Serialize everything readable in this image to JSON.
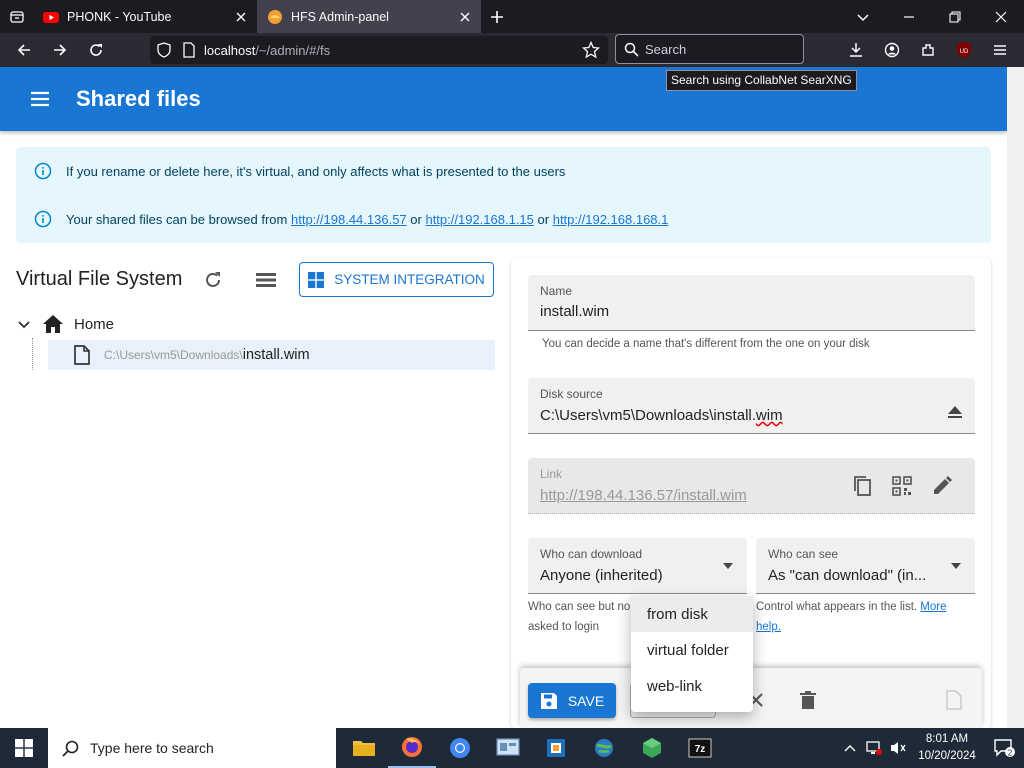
{
  "browser": {
    "tabs": [
      {
        "title": "PHONK - YouTube",
        "active": false
      },
      {
        "title": "HFS Admin-panel",
        "active": true
      }
    ],
    "url_host": "localhost",
    "url_path": "/~/admin/#/fs",
    "search_placeholder": "Search",
    "search_tooltip": "Search using CollabNet SearXNG",
    "ext_badge": "UD"
  },
  "app": {
    "title": "Shared files",
    "alerts": {
      "rename_notice": "If you rename or delete here, it's virtual, and only affects what is presented to the users",
      "browse_prefix": "Your shared files can be browsed from",
      "links": [
        "http://198.44.136.57",
        "http://192.168.1.15",
        "http://192.168.168.1"
      ],
      "or": "or"
    },
    "vfs": {
      "title": "Virtual File System",
      "system_integration_label": "SYSTEM INTEGRATION",
      "home_label": "Home",
      "file_path": "C:\\Users\\vm5\\Downloads\\",
      "file_name": "install.wim"
    },
    "details": {
      "name_label": "Name",
      "name_value": "install.wim",
      "name_helper": "You can decide a name that's different from the one on your disk",
      "source_label": "Disk source",
      "source_value_prefix": "C:\\Users\\vm5\\Downloads\\install.",
      "source_value_suffix": "wim",
      "link_label": "Link",
      "link_value": "http://198.44.136.57/install.wim",
      "who_download_label": "Who can download",
      "who_download_value": "Anyone (inherited)",
      "who_see_label": "Who can see",
      "who_see_value": "As \"can download\" (in...",
      "who_see_helper_left_1": "Who can see but no",
      "who_see_helper_left_2": "asked to login",
      "who_see_helper_right": "Control what appears in the list.",
      "more_link": "More",
      "help_link": "help."
    },
    "toolbar": {
      "save_label": "SAVE"
    },
    "add_menu": {
      "items": [
        "from disk",
        "virtual folder",
        "web-link"
      ]
    }
  },
  "taskbar": {
    "search_placeholder": "Type here to search",
    "time": "8:01 AM",
    "date": "10/20/2024",
    "notification_count": "2"
  },
  "colors": {
    "primary": "#1976d2",
    "alert_bg": "#e5f6fd",
    "browser_dark": "#1c1b22",
    "taskbar": "#1f2a38"
  }
}
